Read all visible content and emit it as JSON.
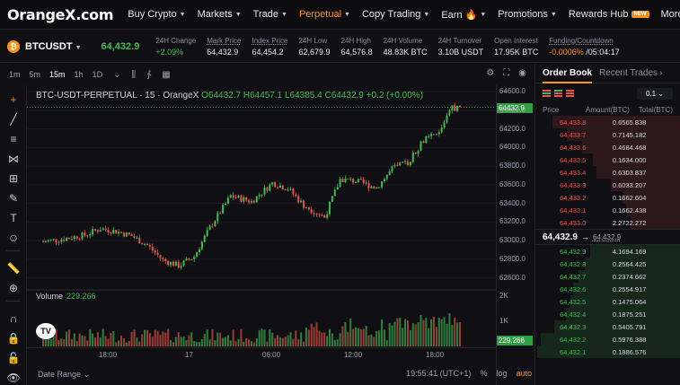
{
  "nav": {
    "logo": "OrangeX.com",
    "items": [
      {
        "label": "Buy Crypto",
        "chev": true
      },
      {
        "label": "Markets",
        "chev": true
      },
      {
        "label": "Trade",
        "chev": true
      },
      {
        "label": "Perpetual",
        "chev": true,
        "active": true
      },
      {
        "label": "Copy Trading",
        "chev": true
      },
      {
        "label": "Earn 🔥",
        "chev": true
      },
      {
        "label": "Promotions",
        "chev": true
      },
      {
        "label": "Rewards Hub",
        "badge": "NEW"
      },
      {
        "label": "More",
        "chev": true
      }
    ]
  },
  "ticker": {
    "coin_glyph": "₿",
    "symbol": "BTCUSDT",
    "last_price": "64,432.9",
    "stats": [
      {
        "label": "24H Change",
        "value": "+2.09%",
        "tone": "green"
      },
      {
        "label": "Mark Price",
        "value": "64,432.9",
        "underline": true
      },
      {
        "label": "Index Price",
        "value": "64,454.2",
        "underline": true
      },
      {
        "label": "24H Low",
        "value": "62,679.9"
      },
      {
        "label": "24H High",
        "value": "64,576.8"
      },
      {
        "label": "24H Volume",
        "value": "48.83K BTC"
      },
      {
        "label": "24H Turnover",
        "value": "3.10B USDT"
      },
      {
        "label": "Open Interest",
        "value": "17.95K BTC"
      },
      {
        "label": "Funding/Countdown",
        "value_a": "-0.0006%",
        "value_b": " /05:04:17",
        "underline": true
      }
    ]
  },
  "toolbar": {
    "timeframes": [
      "1m",
      "5m",
      "15m",
      "1h",
      "1D"
    ],
    "active_timeframe": "15m"
  },
  "chart": {
    "title_main": "BTC-USDT-PERPETUAL · 15 · OrangeX",
    "open": "O64432.7",
    "high": "H64457.1",
    "low": "L64385.4",
    "close": "C64432.9",
    "change": "+0.2 (+0.00%)",
    "volume_label": "Volume",
    "volume_value": "229.266",
    "current_price_tag": "64432.9",
    "volume_tag": "229.266",
    "price_ticks": [
      "64600.0",
      "64400.0",
      "64200.0",
      "64000.0",
      "63800.0",
      "63600.0",
      "63400.0",
      "63200.0",
      "63000.0",
      "62800.0",
      "62600.0"
    ],
    "volume_ticks": [
      "2K",
      "1K"
    ],
    "time_ticks": [
      "18:00",
      "17",
      "06:00",
      "12:00",
      "18:00"
    ],
    "date_range": "Date Range",
    "clock": "19:55:41 (UTC+1)",
    "pct": "%",
    "log": "log",
    "auto": "auto",
    "tv_logo": "TV",
    "chart_data": {
      "type": "candlestick",
      "price_range": [
        62500,
        64650
      ],
      "keypoints": [
        [
          0,
          62990
        ],
        [
          8,
          63020
        ],
        [
          16,
          63060
        ],
        [
          22,
          63130
        ],
        [
          28,
          63100
        ],
        [
          34,
          63050
        ],
        [
          40,
          62950
        ],
        [
          46,
          62790
        ],
        [
          52,
          62730
        ],
        [
          58,
          62830
        ],
        [
          64,
          63140
        ],
        [
          72,
          63480
        ],
        [
          80,
          63420
        ],
        [
          88,
          63620
        ],
        [
          94,
          63560
        ],
        [
          100,
          63380
        ],
        [
          108,
          63250
        ],
        [
          114,
          63660
        ],
        [
          120,
          63640
        ],
        [
          128,
          63570
        ],
        [
          134,
          63770
        ],
        [
          140,
          63840
        ],
        [
          146,
          64080
        ],
        [
          152,
          64150
        ],
        [
          156,
          64420
        ],
        [
          160,
          64432.9
        ]
      ],
      "volume_range": [
        0,
        2500
      ]
    }
  },
  "orderbook": {
    "tabs": [
      "Order Book",
      "Recent Trades"
    ],
    "active_tab": "Order Book",
    "precision": "0.1",
    "headers": [
      "Price",
      "Amount(BTC)",
      "Total(BTC)"
    ],
    "asks": [
      {
        "price": "64,433.8",
        "amount": "0.656",
        "total": "5.838",
        "depth": 0.88
      },
      {
        "price": "64,433.7",
        "amount": "0.714",
        "total": "5.182",
        "depth": 0.78
      },
      {
        "price": "64,433.6",
        "amount": "0.468",
        "total": "4.468",
        "depth": 0.68
      },
      {
        "price": "64,433.5",
        "amount": "0.163",
        "total": "4.000",
        "depth": 0.6
      },
      {
        "price": "64,433.4",
        "amount": "0.630",
        "total": "3.837",
        "depth": 0.58
      },
      {
        "price": "64,433.3",
        "amount": "0.603",
        "total": "3.207",
        "depth": 0.48
      },
      {
        "price": "64,433.2",
        "amount": "0.166",
        "total": "2.604",
        "depth": 0.4
      },
      {
        "price": "64,433.1",
        "amount": "0.166",
        "total": "2.438",
        "depth": 0.37
      },
      {
        "price": "64,433.0",
        "amount": "2.272",
        "total": "2.272",
        "depth": 0.34
      }
    ],
    "mid_price": "64,432.9",
    "mid_arrow": "→",
    "mark_price": "64,432.9",
    "bids": [
      {
        "price": "64,432.9",
        "amount": "4.169",
        "total": "4.169",
        "depth": 0.62
      },
      {
        "price": "64,432.8",
        "amount": "0.256",
        "total": "4.425",
        "depth": 0.66
      },
      {
        "price": "64,432.7",
        "amount": "0.237",
        "total": "4.662",
        "depth": 0.7
      },
      {
        "price": "64,432.6",
        "amount": "0.255",
        "total": "4.917",
        "depth": 0.74
      },
      {
        "price": "64,432.5",
        "amount": "0.147",
        "total": "5.064",
        "depth": 0.76
      },
      {
        "price": "64,432.4",
        "amount": "0.187",
        "total": "5.251",
        "depth": 0.79
      },
      {
        "price": "64,432.3",
        "amount": "0.540",
        "total": "5.791",
        "depth": 0.87
      },
      {
        "price": "64,432.2",
        "amount": "0.597",
        "total": "6.388",
        "depth": 0.96
      },
      {
        "price": "64,432.1",
        "amount": "0.188",
        "total": "6.576",
        "depth": 0.99
      }
    ]
  }
}
